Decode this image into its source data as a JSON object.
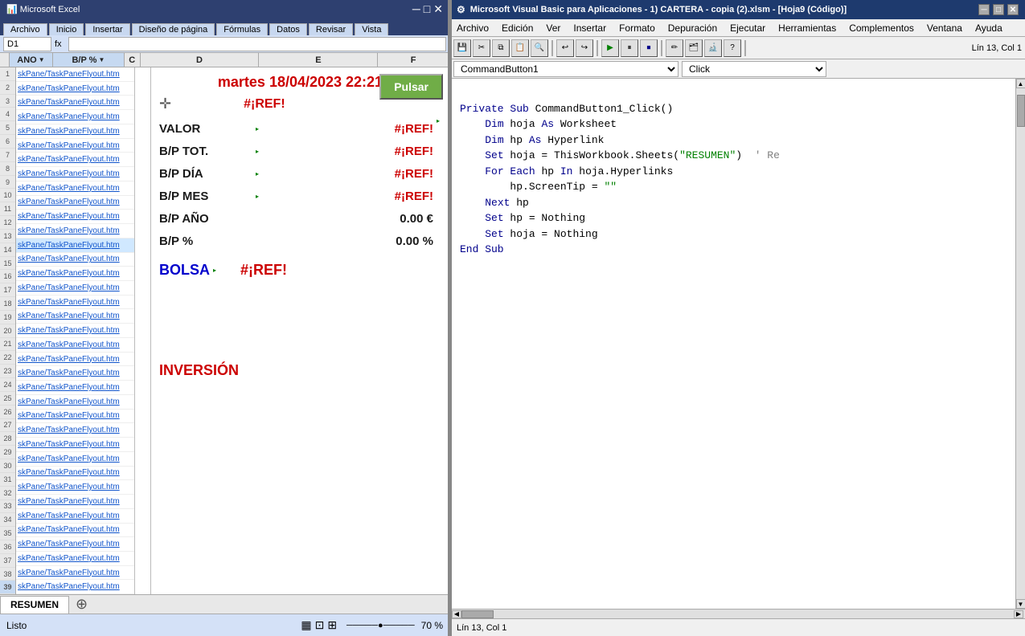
{
  "excel": {
    "title": "Microsoft Excel",
    "sheet_name": "RESUMEN",
    "date_display": "martes  18/04/2023  22:21",
    "columns": [
      "ANO",
      "B/P %",
      "C",
      "D",
      "E",
      "F"
    ],
    "cells": {
      "ref_error": "#¡REF!",
      "valor_label": "VALOR",
      "valor_value": "#¡REF!",
      "bp_tot_label": "B/P TOT.",
      "bp_tot_value": "#¡REF!",
      "bp_dia_label": "B/P DÍA",
      "bp_dia_value": "#¡REF!",
      "bp_mes_label": "B/P MES",
      "bp_mes_value": "#¡REF!",
      "bp_ano_label": "B/P AÑO",
      "bp_ano_value": "0.00 €",
      "bp_pct_label": "B/P %",
      "bp_pct_value": "0.00 %",
      "bolsa_label": "BOLSA",
      "bolsa_value": "#¡REF!",
      "inversion_label": "INVERSIÓN"
    },
    "pulsar_button": "Pulsar",
    "status": "Listo",
    "zoom": "70 %",
    "links": [
      "skPane/TaskPaneFlyout.htm",
      "skPane/TaskPaneFlyout.htm",
      "skPane/TaskPaneFlyout.htm",
      "skPane/TaskPaneFlyout.htm",
      "skPane/TaskPaneFlyout.htm",
      "skPane/TaskPaneFlyout.htm",
      "skPane/TaskPaneFlyout.htm",
      "skPane/TaskPaneFlyout.htm",
      "skPane/TaskPaneFlyout.htm",
      "skPane/TaskPaneFlyout.htm",
      "skPane/TaskPaneFlyout.htm",
      "skPane/TaskPaneFlyout.htm",
      "skPane/TaskPaneFlyout.htm",
      "skPane/TaskPaneFlyout.htm",
      "skPane/TaskPaneFlyout.htm",
      "skPane/TaskPaneFlyout.htm",
      "skPane/TaskPaneFlyout.htm",
      "skPane/TaskPaneFlyout.htm",
      "skPane/TaskPaneFlyout.htm",
      "skPane/TaskPaneFlyout.htm",
      "skPane/TaskPaneFlyout.htm",
      "skPane/TaskPaneFlyout.htm",
      "skPane/TaskPaneFlyout.htm",
      "skPane/TaskPaneFlyout.htm",
      "skPane/TaskPaneFlyout.htm",
      "skPane/TaskPaneFlyout.htm",
      "skPane/TaskPaneFlyout.htm",
      "skPane/TaskPaneFlyout.htm",
      "skPane/TaskPaneFlyout.htm",
      "skPane/TaskPaneFlyout.htm",
      "skPane/TaskPaneFlyout.htm",
      "skPane/TaskPaneFlyout.htm",
      "skPane/TaskPaneFlyout.htm",
      "skPane/TaskPaneFlyout.htm",
      "skPane/TaskPaneFlyout.htm",
      "skPane/TaskPaneFlyout.htm",
      "skPane/TaskPaneFlyout.htm"
    ]
  },
  "vba": {
    "title": "Microsoft Visual Basic para Aplicaciones - 1) CARTERA - copia (2).xlsm - [Hoja9 (Código)]",
    "menus": [
      "Archivo",
      "Edición",
      "Ver",
      "Insertar",
      "Formato",
      "Depuración",
      "Ejecutar",
      "Herramientas",
      "Complementos",
      "Ventana",
      "Ayuda"
    ],
    "combo_left": "CommandButton1",
    "combo_right": "Click",
    "status_text": "Lín 13, Col 1",
    "code_lines": [
      "",
      "Private Sub CommandButton1_Click()",
      "    Dim hoja As Worksheet",
      "    Dim hp As Hyperlink",
      "    Set hoja = ThisWorkbook.Sheets(\"RESUMEN\")  ' Re",
      "    For Each hp In hoja.Hyperlinks",
      "        hp.ScreenTip = \"\"",
      "    Next hp",
      "    Set hp = Nothing",
      "    Set hoja = Nothing",
      "End Sub"
    ],
    "code_keywords": [
      "Private",
      "Sub",
      "Dim",
      "As",
      "Set",
      "For",
      "Each",
      "In",
      "Next",
      "End"
    ],
    "code_objects": [
      "CommandButton1_Click",
      "hoja",
      "hp",
      "Worksheet",
      "Hyperlink",
      "ThisWorkbook",
      "Sheets",
      "Hyperlinks",
      "ScreenTip",
      "Nothing"
    ]
  }
}
